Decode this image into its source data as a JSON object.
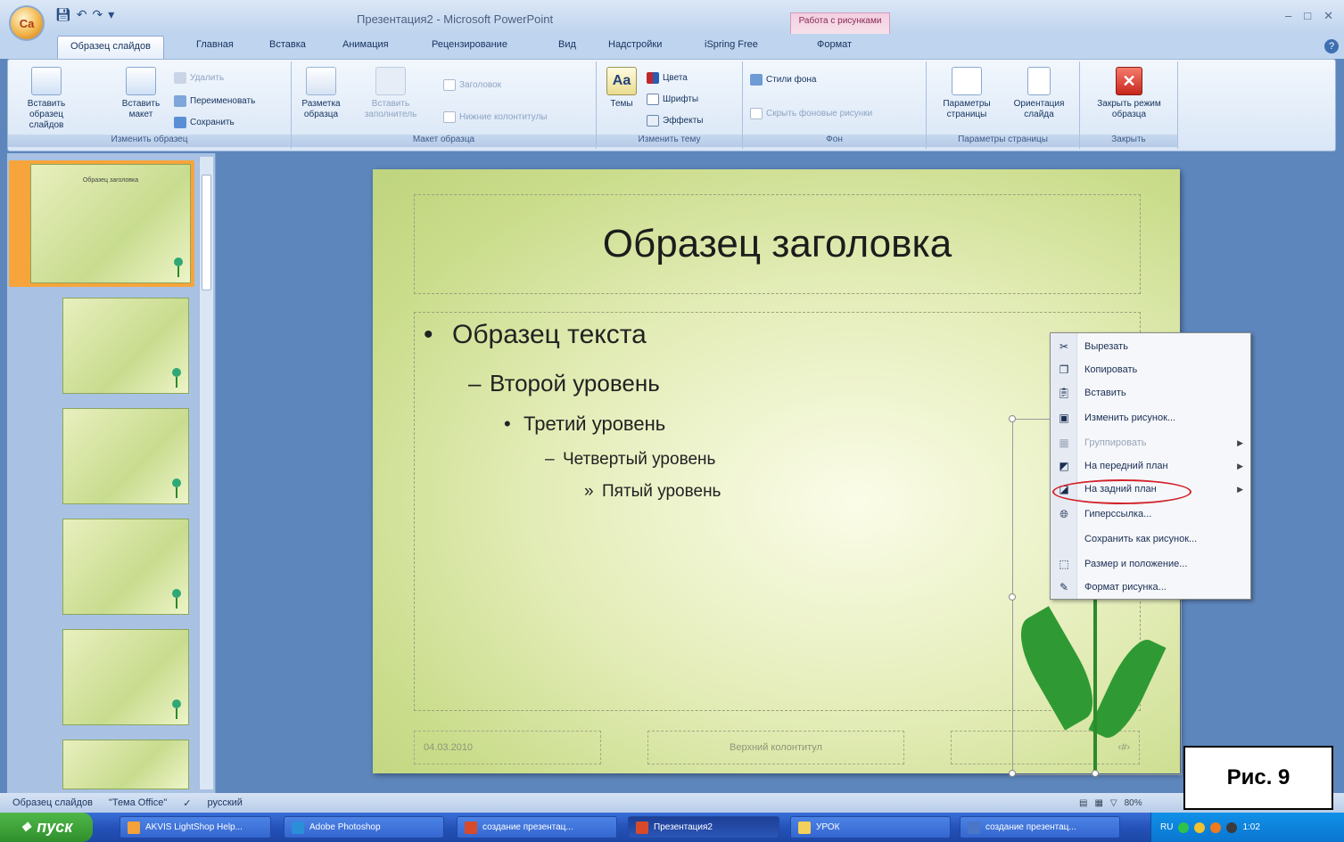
{
  "window": {
    "title": "Презентация2 - Microsoft PowerPoint",
    "contextual_tab": "Работа с рисунками",
    "office_button_label": "Ca"
  },
  "tabs": [
    "Образец слайдов",
    "Главная",
    "Вставка",
    "Анимация",
    "Рецензирование",
    "Вид",
    "Надстройки",
    "iSpring Free",
    "Формат"
  ],
  "ribbon": {
    "edit_master": {
      "label": "Изменить образец",
      "insert_master": "Вставить образец слайдов",
      "insert_layout": "Вставить макет",
      "delete": "Удалить",
      "rename": "Переименовать",
      "preserve": "Сохранить"
    },
    "master_layout": {
      "label": "Макет образца",
      "master_layout_btn": "Разметка образца",
      "insert_placeholder": "Вставить заполнитель",
      "title_chk": "Заголовок",
      "footers_chk": "Нижние колонтитулы"
    },
    "edit_theme": {
      "label": "Изменить тему",
      "themes": "Темы",
      "colors": "Цвета",
      "fonts": "Шрифты",
      "effects": "Эффекты"
    },
    "background": {
      "label": "Фон",
      "styles": "Стили фона",
      "hide": "Скрыть фоновые рисунки"
    },
    "page_setup": {
      "label": "Параметры страницы",
      "page_setup_btn": "Параметры страницы",
      "orientation": "Ориентация слайда"
    },
    "close": {
      "label": "Закрыть",
      "close_master": "Закрыть режим образца"
    }
  },
  "thumbnails": {
    "master_title": "Образец заголовка"
  },
  "slide": {
    "title": "Образец заголовка",
    "level1": "Образец текста",
    "level2": "Второй уровень",
    "level3": "Третий уровень",
    "level4": "Четвертый уровень",
    "level5": "Пятый уровень",
    "bullet1": "•",
    "bullet2": "–",
    "bullet3": "•",
    "bullet4": "–",
    "bullet5": "»",
    "footer_date": "04.03.2010",
    "footer_center": "Верхний колонтитул",
    "footer_number": "‹#›"
  },
  "context_menu": [
    {
      "label": "Вырезать",
      "icon": "scissors-icon",
      "submenu": false,
      "disabled": false
    },
    {
      "label": "Копировать",
      "icon": "copy-icon",
      "submenu": false,
      "disabled": false
    },
    {
      "label": "Вставить",
      "icon": "paste-icon",
      "submenu": false,
      "disabled": false
    },
    {
      "label": "Изменить рисунок...",
      "icon": "change-picture-icon",
      "submenu": false,
      "disabled": false
    },
    {
      "label": "Группировать",
      "icon": "group-icon",
      "submenu": true,
      "disabled": true
    },
    {
      "label": "На передний план",
      "icon": "bring-front-icon",
      "submenu": true,
      "disabled": false
    },
    {
      "label": "На задний план",
      "icon": "send-back-icon",
      "submenu": true,
      "disabled": false
    },
    {
      "label": "Гиперссылка...",
      "icon": "hyperlink-icon",
      "submenu": false,
      "disabled": false
    },
    {
      "label": "Сохранить как рисунок...",
      "icon": "",
      "submenu": false,
      "disabled": false
    },
    {
      "label": "Размер и положение...",
      "icon": "size-icon",
      "submenu": false,
      "disabled": false
    },
    {
      "label": "Формат рисунка...",
      "icon": "format-picture-icon",
      "submenu": false,
      "disabled": false
    }
  ],
  "statusbar": {
    "view": "Образец слайдов",
    "theme": "\"Тема Office\"",
    "language": "русский",
    "zoom": "80%"
  },
  "figure_label": "Рис. 9",
  "taskbar": {
    "start": "пуск",
    "items": [
      "AKVIS LightShop Help...",
      "Adobe Photoshop",
      "создание презентац...",
      "Презентация2",
      "УРОК",
      "создание презентац..."
    ],
    "lang": "RU",
    "clock": "1:02"
  },
  "colors": {
    "ribbon_bg": "#d9e6f6",
    "accent_red": "#d3222a",
    "taskbar_blue": "#2452b8",
    "slide_green": "#c9dc8a"
  }
}
